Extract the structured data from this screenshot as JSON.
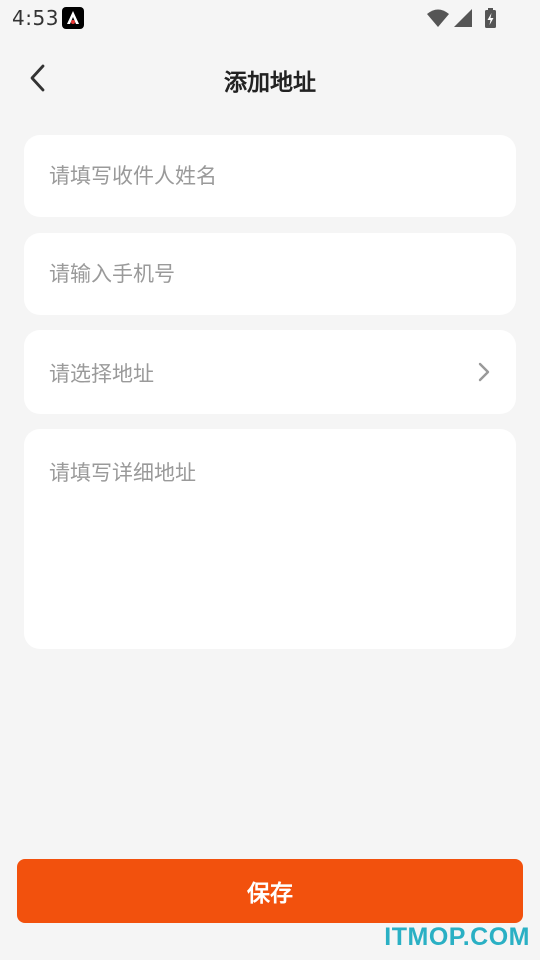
{
  "status_bar": {
    "time": "4:53",
    "app_icon": "app-notification-icon",
    "wifi_icon": "wifi-icon",
    "signal_icon": "cell-signal-icon",
    "battery_icon": "battery-charging-icon"
  },
  "header": {
    "back_icon": "chevron-left-icon",
    "title": "添加地址"
  },
  "form": {
    "name_placeholder": "请填写收件人姓名",
    "phone_placeholder": "请输入手机号",
    "address_select_label": "请选择地址",
    "address_select_icon": "chevron-right-icon",
    "detail_placeholder": "请填写详细地址"
  },
  "footer": {
    "save_label": "保存"
  },
  "watermark": "ITMOP.COM",
  "colors": {
    "accent": "#f2510d",
    "background": "#f5f5f5",
    "card": "#ffffff",
    "placeholder": "#9a9a9a",
    "watermark": "#2ab0c4"
  }
}
